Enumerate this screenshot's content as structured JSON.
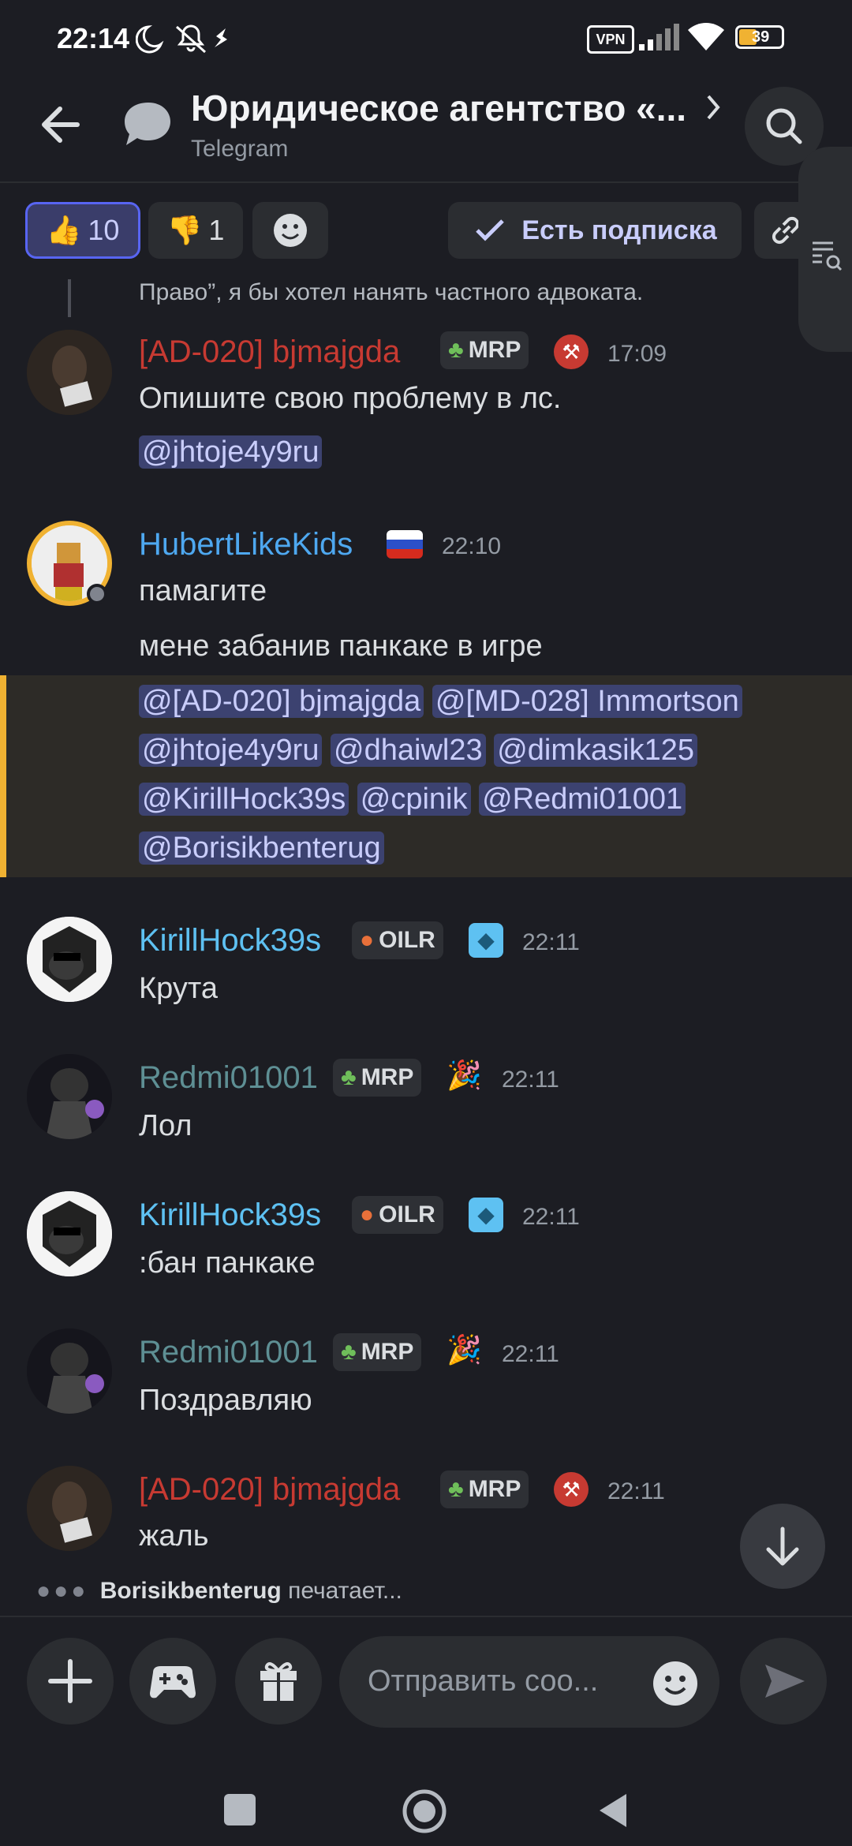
{
  "status": {
    "time": "22:14",
    "vpn": "VPN",
    "battery": "39"
  },
  "header": {
    "title": "Юридическое агентство «...",
    "subtitle": "Telegram"
  },
  "reactions": {
    "like": {
      "emoji": "👍",
      "count": "10"
    },
    "dislike": {
      "emoji": "👎",
      "count": "1"
    },
    "subscription_label": "Есть подписка"
  },
  "messages": {
    "quote": "Право”, я бы хотел нанять частного адвоката.",
    "m1": {
      "user": "[AD-020] bjmajgda",
      "tag": "MRP",
      "time": "17:09",
      "text": "Опишите свою проблему в лс.",
      "mention": "@jhtoje4y9ru"
    },
    "m2": {
      "user": "HubertLikeKids",
      "time": "22:10",
      "line1": "памагите",
      "line2": "мене забанив панкаке в игре",
      "mentions": [
        "@[AD-020] bjmajgda",
        "@[MD-028] Immortson",
        "@jhtoje4y9ru",
        "@dhaiwl23",
        "@dimkasik125",
        "@KirillHock39s",
        "@cpinik",
        "@Redmi01001",
        "@Borisikbenterug"
      ]
    },
    "m3": {
      "user": "KirillHock39s",
      "tag": "OILR",
      "time": "22:11",
      "text": "Крута"
    },
    "m4": {
      "user": "Redmi01001",
      "tag": "MRP",
      "time": "22:11",
      "text": "Лол"
    },
    "m5": {
      "user": "KirillHock39s",
      "tag": "OILR",
      "time": "22:11",
      "text": ":бан панкаке"
    },
    "m6": {
      "user": "Redmi01001",
      "tag": "MRP",
      "time": "22:11",
      "text": "Поздравляю"
    },
    "m7": {
      "user": "[AD-020] bjmajgda",
      "tag": "MRP",
      "time": "22:11",
      "text": "жаль"
    }
  },
  "typing": {
    "user": "Borisikbenterug",
    "suffix": "печатает..."
  },
  "composer": {
    "placeholder": "Отправить соо..."
  },
  "colors": {
    "accent": "#5865f2",
    "red_user": "#c73a32",
    "blue_user": "#4ea8f0",
    "teal_user": "#5e8f94",
    "highlight_bar": "#f0b232"
  }
}
